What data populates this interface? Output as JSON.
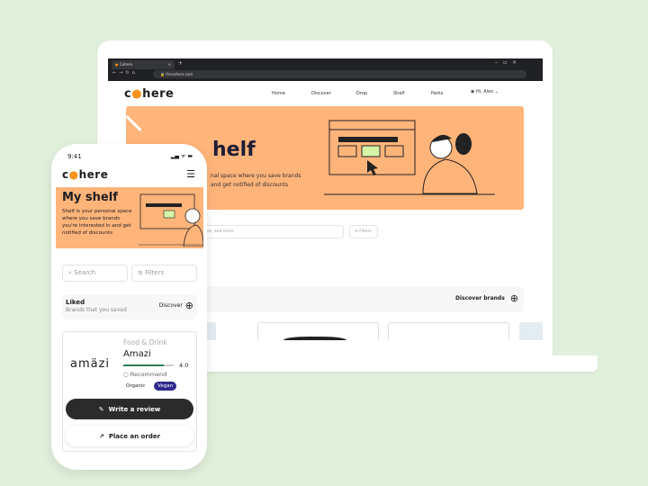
{
  "desktop": {
    "tab_title": "Cohere",
    "url": "thecohere.com",
    "logo": "cohere",
    "nav": [
      "Home",
      "Discover",
      "Drop",
      "Shelf",
      "Parks"
    ],
    "user": "Hi, Alex",
    "banner_title": "My shelf",
    "banner_visible_title": "helf",
    "banner_line1": "nal space where you save brands",
    "banner_line2": "and get notified of discounts",
    "search_placeholder": "nds, and more",
    "filters": "Filters",
    "discover_brands": "Discover brands"
  },
  "phone": {
    "time": "9:41",
    "logo": "cohere",
    "banner_title": "My shelf",
    "banner_text": "Shelf is your personal space where you save brands you're interested in and get notified of discounts",
    "search_placeholder": "Search",
    "filters": "Filters",
    "liked_title": "Liked",
    "liked_sub": "Brands that you saved",
    "discover": "Discover",
    "card": {
      "brand_logo": "amäzi",
      "category": "Food & Drink",
      "name": "Amazi",
      "rating": "4.0",
      "rating_value": 4.0,
      "rating_max": 5,
      "recommend": "Recommend",
      "tags": [
        "Organic",
        "Vegan"
      ],
      "write_review": "Write a review",
      "place_order": "Place an order"
    }
  },
  "colors": {
    "background": "#e1f0dc",
    "banner": "#ffb47a",
    "accent_dot": "#f7931e",
    "vegan_tag": "#2e2a8c",
    "dark_button": "#2b2b2b",
    "rating_bar": "#2f7d4f"
  }
}
